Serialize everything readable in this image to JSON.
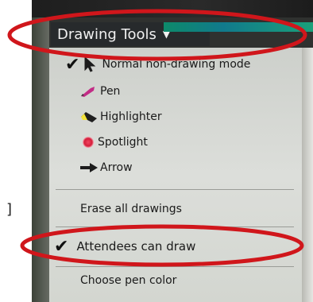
{
  "toolbar": {
    "title": "Drawing Tools",
    "dropdown_icon": "caret-down-icon"
  },
  "menu": {
    "tools": [
      {
        "label": "Normal non-drawing mode",
        "icon": "cursor-arrow-icon",
        "checked": true
      },
      {
        "label": "Pen",
        "icon": "pen-icon",
        "checked": false
      },
      {
        "label": "Highlighter",
        "icon": "highlighter-icon",
        "checked": false
      },
      {
        "label": "Spotlight",
        "icon": "spotlight-icon",
        "checked": false
      },
      {
        "label": "Arrow",
        "icon": "arrow-icon",
        "checked": false
      }
    ],
    "erase_label": "Erase all drawings",
    "attendees_label": "Attendees can draw",
    "attendees_checked": true,
    "pen_color_label": "Choose pen color"
  },
  "colors": {
    "annotation_red": "#d0161b",
    "pen_magenta": "#c22c86",
    "spotlight_red": "#d41e3a",
    "highlighter_yellow": "#f3e33a",
    "toolbar_dark": "#2f312f",
    "menu_bg": "#d9dbd6"
  }
}
